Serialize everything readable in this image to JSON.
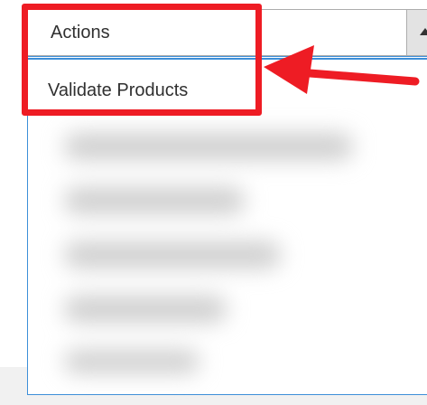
{
  "actions_select": {
    "selected_label": "Actions",
    "caret_icon": "caret-up-icon"
  },
  "dropdown": {
    "items": [
      {
        "label": "Validate Products"
      }
    ]
  },
  "annotation": {
    "color": "#ee1c24",
    "arrow_icon": "arrow-left-icon"
  },
  "colors": {
    "accent_border": "#3d8fd8",
    "text": "#303030"
  }
}
